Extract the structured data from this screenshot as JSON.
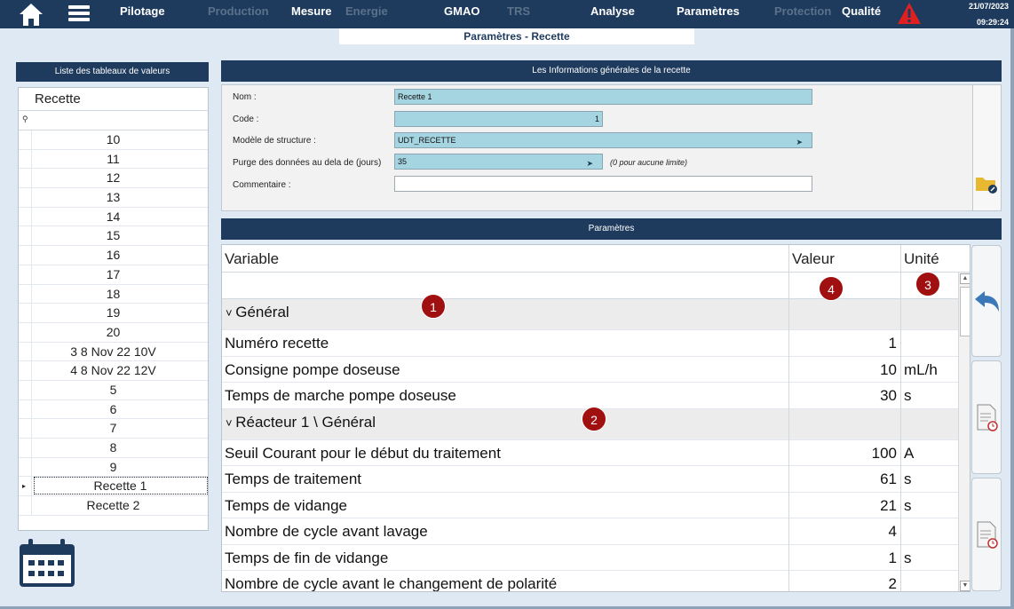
{
  "nav": {
    "items": [
      {
        "label": "Pilotage",
        "dim": false
      },
      {
        "label": "Production",
        "dim": true
      },
      {
        "label": "Mesure",
        "dim": false
      },
      {
        "label": "Energie",
        "dim": true
      },
      {
        "label": "GMAO",
        "dim": false
      },
      {
        "label": "TRS",
        "dim": true
      },
      {
        "label": "Analyse",
        "dim": false
      },
      {
        "label": "Paramètres",
        "dim": false
      },
      {
        "label": "Protection",
        "dim": true
      },
      {
        "label": "Qualité",
        "dim": false
      }
    ],
    "date": "21/07/2023",
    "time": "09:29:24",
    "icons": {
      "home": "home-icon",
      "menu": "menu-icon",
      "alert": "alert-triangle-icon"
    },
    "alert_color": "#e02020"
  },
  "page_title": "Paramètres - Recette",
  "left": {
    "header": "Liste des tableaux de valeurs",
    "column": "Recette",
    "rows": [
      "10",
      "11",
      "12",
      "13",
      "14",
      "15",
      "16",
      "17",
      "18",
      "19",
      "20",
      "3 8 Nov 22 10V",
      "4 8 Nov 22 12V",
      "5",
      "6",
      "7",
      "8",
      "9",
      "Recette 1",
      "Recette 2"
    ],
    "selected": "Recette 1"
  },
  "general": {
    "header": "Les Informations générales de la recette",
    "nom_label": "Nom :",
    "nom_value": "Recette 1",
    "code_label": "Code :",
    "code_value": "1",
    "modele_label": "Modèle de structure :",
    "modele_value": "UDT_RECETTE",
    "purge_label": "Purge des données au dela de (jours)",
    "purge_value": "35",
    "purge_note": "(0 pour aucune limite)",
    "commentaire_label": "Commentaire :",
    "commentaire_value": ""
  },
  "params": {
    "header": "Paramètres",
    "col_variable": "Variable",
    "col_valeur": "Valeur",
    "col_unite": "Unité",
    "rows": [
      {
        "group": true,
        "variable": "Général",
        "value": "",
        "unit": ""
      },
      {
        "group": false,
        "variable": "Numéro recette",
        "value": "1",
        "unit": ""
      },
      {
        "group": false,
        "variable": "Consigne pompe doseuse",
        "value": "10",
        "unit": "mL/h"
      },
      {
        "group": false,
        "variable": "Temps de marche pompe doseuse",
        "value": "30",
        "unit": "s"
      },
      {
        "group": true,
        "variable": "Réacteur 1 \\ Général",
        "value": "",
        "unit": ""
      },
      {
        "group": false,
        "variable": "Seuil Courant pour le début du traitement",
        "value": "100",
        "unit": "A"
      },
      {
        "group": false,
        "variable": "Temps de traitement",
        "value": "61",
        "unit": "s"
      },
      {
        "group": false,
        "variable": "Temps de vidange",
        "value": "21",
        "unit": "s"
      },
      {
        "group": false,
        "variable": "Nombre de cycle avant lavage",
        "value": "4",
        "unit": ""
      },
      {
        "group": false,
        "variable": "Temps de fin de vidange",
        "value": "1",
        "unit": "s"
      },
      {
        "group": false,
        "variable": "Nombre de cycle avant le changement de polarité",
        "value": "2",
        "unit": ""
      }
    ]
  },
  "markers": [
    "1",
    "2",
    "3",
    "4"
  ],
  "colors": {
    "nav": "#1e3b5e",
    "field": "#a6d5e2",
    "marker": "#a01010"
  }
}
